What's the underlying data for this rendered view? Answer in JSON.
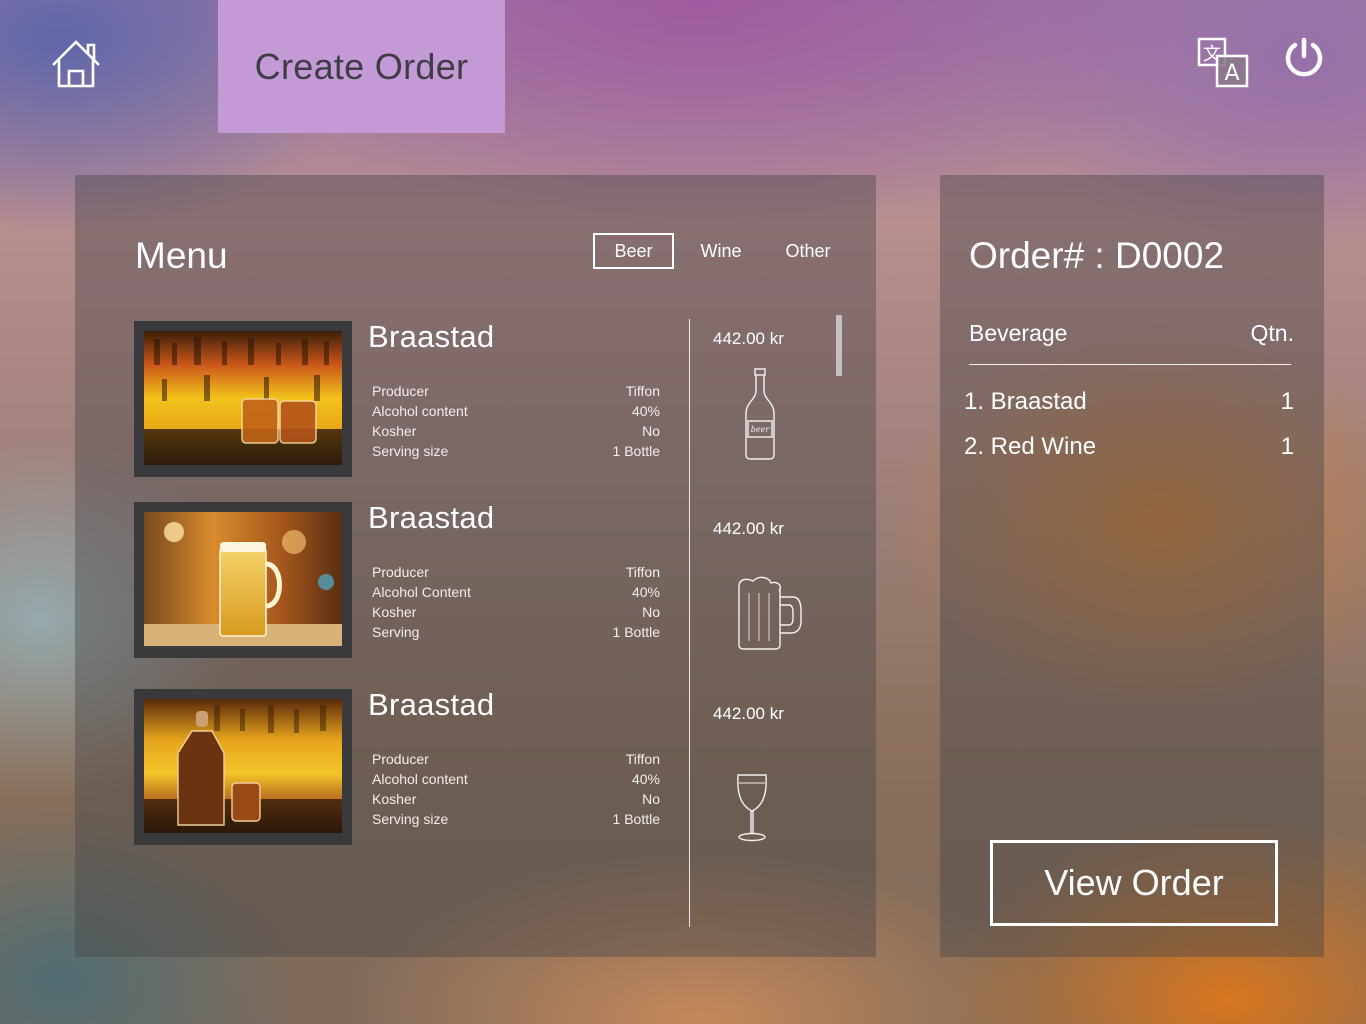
{
  "header": {
    "home_icon": "home-icon",
    "create_order_label": "Create Order",
    "language_icon": "translate-icon",
    "power_icon": "power-icon",
    "accent_color": "#c39ad6"
  },
  "menu": {
    "title": "Menu",
    "tabs": [
      {
        "label": "Beer",
        "active": true
      },
      {
        "label": "Wine",
        "active": false
      },
      {
        "label": "Other",
        "active": false
      }
    ],
    "items": [
      {
        "name": "Braastad",
        "image": "whisky-glasses-bar-photo",
        "specs": [
          {
            "label": "Producer",
            "value": "Tiffon"
          },
          {
            "label": "Alcohol content",
            "value": "40%"
          },
          {
            "label": "Kosher",
            "value": "No"
          },
          {
            "label": "Serving size",
            "value": "1 Bottle"
          }
        ],
        "price": "442.00 kr",
        "drink_icon": "beer-bottle-icon"
      },
      {
        "name": "Braastad",
        "image": "beer-mug-pub-photo",
        "specs": [
          {
            "label": "Producer",
            "value": "Tiffon"
          },
          {
            "label": "Alcohol Content",
            "value": "40%"
          },
          {
            "label": "Kosher",
            "value": "No"
          },
          {
            "label": "Serving",
            "value": "1 Bottle"
          }
        ],
        "price": "442.00 kr",
        "drink_icon": "beer-mug-icon"
      },
      {
        "name": "Braastad",
        "image": "decanter-bar-photo",
        "specs": [
          {
            "label": "Producer",
            "value": "Tiffon"
          },
          {
            "label": "Alcohol content",
            "value": "40%"
          },
          {
            "label": "Kosher",
            "value": "No"
          },
          {
            "label": "Serving size",
            "value": "1 Bottle"
          }
        ],
        "price": "442.00 kr",
        "drink_icon": "wine-glass-icon"
      }
    ]
  },
  "order": {
    "title": "Order# : D0002",
    "col_beverage": "Beverage",
    "col_qtn": "Qtn.",
    "lines": [
      {
        "name": "1. Braastad",
        "qty": "1"
      },
      {
        "name": "2. Red Wine",
        "qty": "1"
      }
    ],
    "view_order_label": "View Order"
  }
}
